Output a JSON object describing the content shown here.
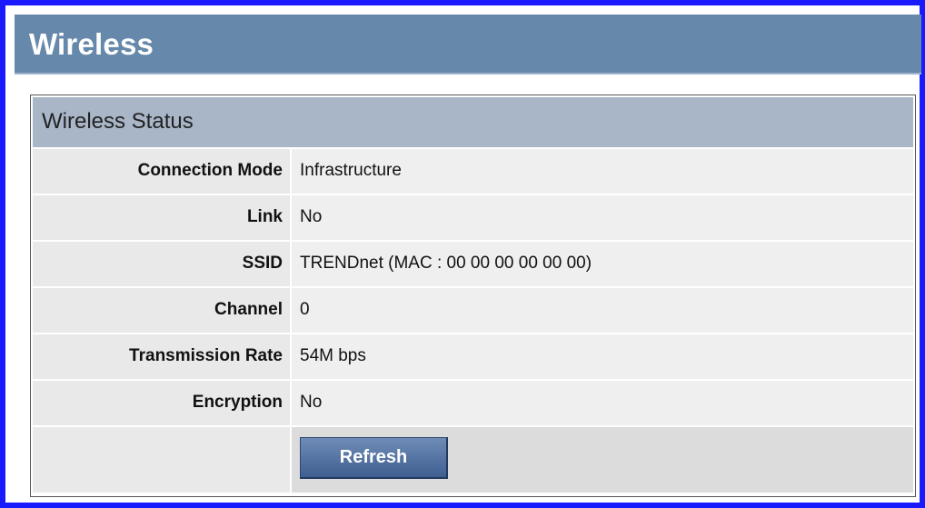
{
  "header": {
    "title": "Wireless"
  },
  "panel": {
    "title": "Wireless Status",
    "rows": [
      {
        "label": "Connection Mode",
        "value": "Infrastructure"
      },
      {
        "label": "Link",
        "value": "No"
      },
      {
        "label": "SSID",
        "value": "TRENDnet (MAC : 00 00 00 00 00 00)"
      },
      {
        "label": "Channel",
        "value": "0"
      },
      {
        "label": "Transmission Rate",
        "value": "54M bps"
      },
      {
        "label": "Encryption",
        "value": "No"
      }
    ],
    "refresh_label": "Refresh"
  },
  "colors": {
    "frame_border": "#1a1aff",
    "header_bg": "#6688aa",
    "panel_title_bg": "#a8b6c8",
    "button_bg": "#4a6a9c"
  }
}
